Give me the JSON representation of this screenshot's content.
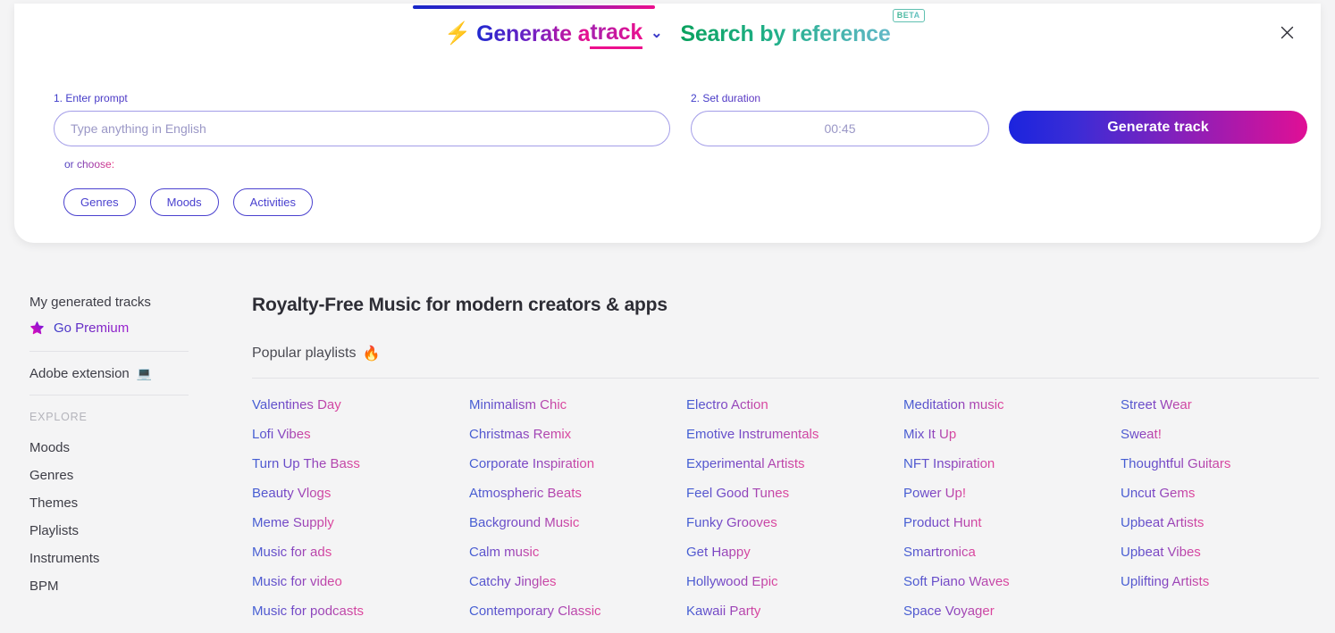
{
  "modal": {
    "close_icon": "close-icon",
    "tabs": [
      {
        "id": "generate-track",
        "bolt_icon": "⚡",
        "label_prefix": "Generate a ",
        "label_emphasis": "track",
        "chevron_icon": "⌄",
        "active": true
      },
      {
        "id": "search-by-reference",
        "label": "Search by reference",
        "badge": "BETA",
        "active": false
      }
    ],
    "form": {
      "prompt_label": "1. Enter prompt",
      "prompt_placeholder": "Type anything in English",
      "prompt_value": "",
      "duration_label": "2. Set duration",
      "duration_placeholder": "00:45",
      "duration_value": "",
      "generate_button": "Generate track",
      "or_choose_label": "or choose:",
      "chips": [
        "Genres",
        "Moods",
        "Activities"
      ]
    }
  },
  "sidebar": {
    "my_tracks": "My generated tracks",
    "premium": {
      "label": "Go Premium",
      "icon": "star-icon"
    },
    "adobe_extension": {
      "label": "Adobe extension",
      "emoji": "💻"
    },
    "explore_heading": "EXPLORE",
    "explore_items": [
      "Moods",
      "Genres",
      "Themes",
      "Playlists",
      "Instruments",
      "BPM"
    ]
  },
  "main": {
    "title": "Royalty-Free Music for modern creators & apps",
    "section_heading": "Popular playlists",
    "section_emoji": "🔥",
    "playlist_columns": [
      [
        "Valentines Day",
        "Lofi Vibes",
        "Turn Up The Bass",
        "Beauty Vlogs",
        "Meme Supply",
        "Music for ads",
        "Music for video",
        "Music for podcasts"
      ],
      [
        "Minimalism Chic",
        "Christmas Remix",
        "Corporate Inspiration",
        "Atmospheric Beats",
        "Background Music",
        "Calm music",
        "Catchy Jingles",
        "Contemporary Classic"
      ],
      [
        "Electro Action",
        "Emotive Instrumentals",
        "Experimental Artists",
        "Feel Good Tunes",
        "Funky Grooves",
        "Get Happy",
        "Hollywood Epic",
        "Kawaii Party"
      ],
      [
        "Meditation music",
        "Mix It Up",
        "NFT Inspiration",
        "Power Up!",
        "Product Hunt",
        "Smartronica",
        "Soft Piano Waves",
        "Space Voyager"
      ],
      [
        "Street Wear",
        "Sweat!",
        "Thoughtful Guitars",
        "Uncut Gems",
        "Upbeat Artists",
        "Upbeat Vibes",
        "Uplifting Artists"
      ]
    ]
  },
  "colors": {
    "accent_blue": "#1b24de",
    "accent_pink": "#e00f95",
    "accent_purple": "#7b22bf",
    "teal": "#0aa15e",
    "page_bg": "#f4f4f5",
    "card_bg": "#ffffff",
    "text_dark": "#2d2d35"
  }
}
